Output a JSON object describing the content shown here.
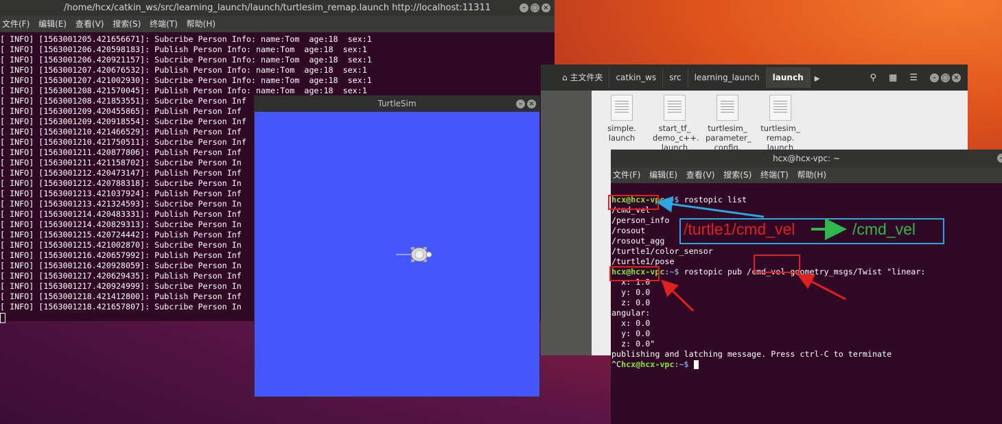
{
  "terminal_left": {
    "title": "/home/hcx/catkin_ws/src/learning_launch/launch/turtlesim_remap.launch http://localhost:11311",
    "menu": [
      "文件(F)",
      "编辑(E)",
      "查看(V)",
      "搜索(S)",
      "终端(T)",
      "帮助(H)"
    ],
    "lines": [
      "[ INFO] [1563001205.421656671]: Subcribe Person Info: name:Tom  age:18  sex:1",
      "[ INFO] [1563001206.420598183]: Publish Person Info: name:Tom  age:18  sex:1",
      "[ INFO] [1563001206.420921157]: Subcribe Person Info: name:Tom  age:18  sex:1",
      "[ INFO] [1563001207.420676532]: Publish Person Info: name:Tom  age:18  sex:1",
      "[ INFO] [1563001207.421002930]: Subcribe Person Info: name:Tom  age:18  sex:1",
      "[ INFO] [1563001208.421570045]: Publish Person Info: name:Tom  age:18  sex:1",
      "[ INFO] [1563001208.421853551]: Subcribe Person Inf",
      "[ INFO] [1563001209.420455865]: Publish Person Inf",
      "[ INFO] [1563001209.420918554]: Subcribe Person Inf",
      "[ INFO] [1563001210.421466529]: Publish Person Inf",
      "[ INFO] [1563001210.421750511]: Subcribe Person Inf",
      "[ INFO] [1563001211.420877806]: Publish Person Inf",
      "[ INFO] [1563001211.421158702]: Subcribe Person In",
      "[ INFO] [1563001212.420473147]: Publish Person Inf",
      "[ INFO] [1563001212.420788318]: Subcribe Person In",
      "[ INFO] [1563001213.421037924]: Publish Person Inf",
      "[ INFO] [1563001213.421324593]: Subcribe Person In",
      "[ INFO] [1563001214.420483331]: Publish Person Inf",
      "[ INFO] [1563001214.420829313]: Subcribe Person In",
      "[ INFO] [1563001215.420724442]: Publish Person Inf",
      "[ INFO] [1563001215.421002870]: Subcribe Person In",
      "[ INFO] [1563001216.420657992]: Publish Person Inf",
      "[ INFO] [1563001216.420928059]: Subcribe Person In",
      "[ INFO] [1563001217.420629435]: Publish Person Inf",
      "[ INFO] [1563001217.420924999]: Subcribe Person In",
      "[ INFO] [1563001218.421412800]: Publish Person Inf",
      "[ INFO] [1563001218.421657807]: Subcribe Person In"
    ]
  },
  "turtlesim": {
    "title": "TurtleSim",
    "background_color": "#4556ff"
  },
  "file_manager": {
    "breadcrumbs": [
      "主文件夹",
      "catkin_ws",
      "src",
      "learning_launch",
      "launch"
    ],
    "files": [
      "simple.\nlaunch",
      "start_tf_\ndemo_c++.\nlaunch",
      "turtlesim_\nparameter_\nconfig.",
      "turtlesim_\nremap.\nlaunch"
    ]
  },
  "terminal_right": {
    "title": "hcx@hcx-vpc: ~",
    "menu": [
      "文件(F)",
      "编辑(E)",
      "查看(V)",
      "搜索(S)",
      "终端(T)",
      "帮助(H)"
    ],
    "prompt_user": "hcx@hcx-vpc",
    "prompt_path": ":~$",
    "cmd1": " rostopic list",
    "topics": [
      "/cmd_vel",
      "/person_info",
      "/rosout",
      "/rosout_agg",
      "/turtle1/color_sensor",
      "/turtle1/pose"
    ],
    "cmd2": " rostopic pub /cmd_vel geometry_msgs/Twist \"linear:",
    "msg_lines": [
      "  x: 1.0",
      "  y: 0.0",
      "  z: 0.0",
      "angular:",
      "  x: 0.0",
      "  y: 0.0",
      "  z: 0.0\""
    ],
    "status": "publishing and latching message. Press ctrl-C to terminate",
    "interrupt": "^C"
  },
  "annotation": {
    "from": "/turtle1/cmd_vel",
    "to": "/cmd_vel",
    "from_color": "#e02020",
    "to_color": "#2fb84c",
    "box_color": "#2ba6e0"
  }
}
